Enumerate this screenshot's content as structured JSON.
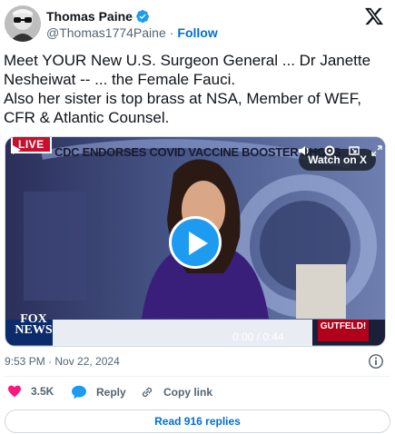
{
  "author": {
    "display_name": "Thomas Paine",
    "handle": "@Thomas1774Paine",
    "separator": "·",
    "follow_label": "Follow",
    "verified_icon": "verified-badge-icon",
    "verified_color": "#1d9bf0"
  },
  "platform_logo": "x-logo-icon",
  "tweet": {
    "lines": [
      "Meet YOUR New U.S. Surgeon General ... Dr Janette",
      "Nesheiwat -- ... the Female Fauci.",
      "Also her sister is top brass at NSA, Member of WEF,",
      "CFR & Atlantic Counsel."
    ]
  },
  "media": {
    "live_badge": "LIVE",
    "watch_on_label": "Watch on X",
    "ticker_text": "CDC ENDORSES COVID VACCINE BOOSTER SHOTS",
    "channel_logo_top": "FOX",
    "channel_logo_bottom": "NEWS",
    "show_badge": "GUTFELD!",
    "time_display": "0:00 / 0:44",
    "progress": 0,
    "accent_color": "#1d9bf0"
  },
  "meta": {
    "timestamp": "9:53 PM · Nov 22, 2024"
  },
  "actions": {
    "likes_count": "3.5K",
    "reply_label": "Reply",
    "copy_link_label": "Copy link",
    "like_color": "#f91880"
  },
  "read_replies_label": "Read 916 replies"
}
